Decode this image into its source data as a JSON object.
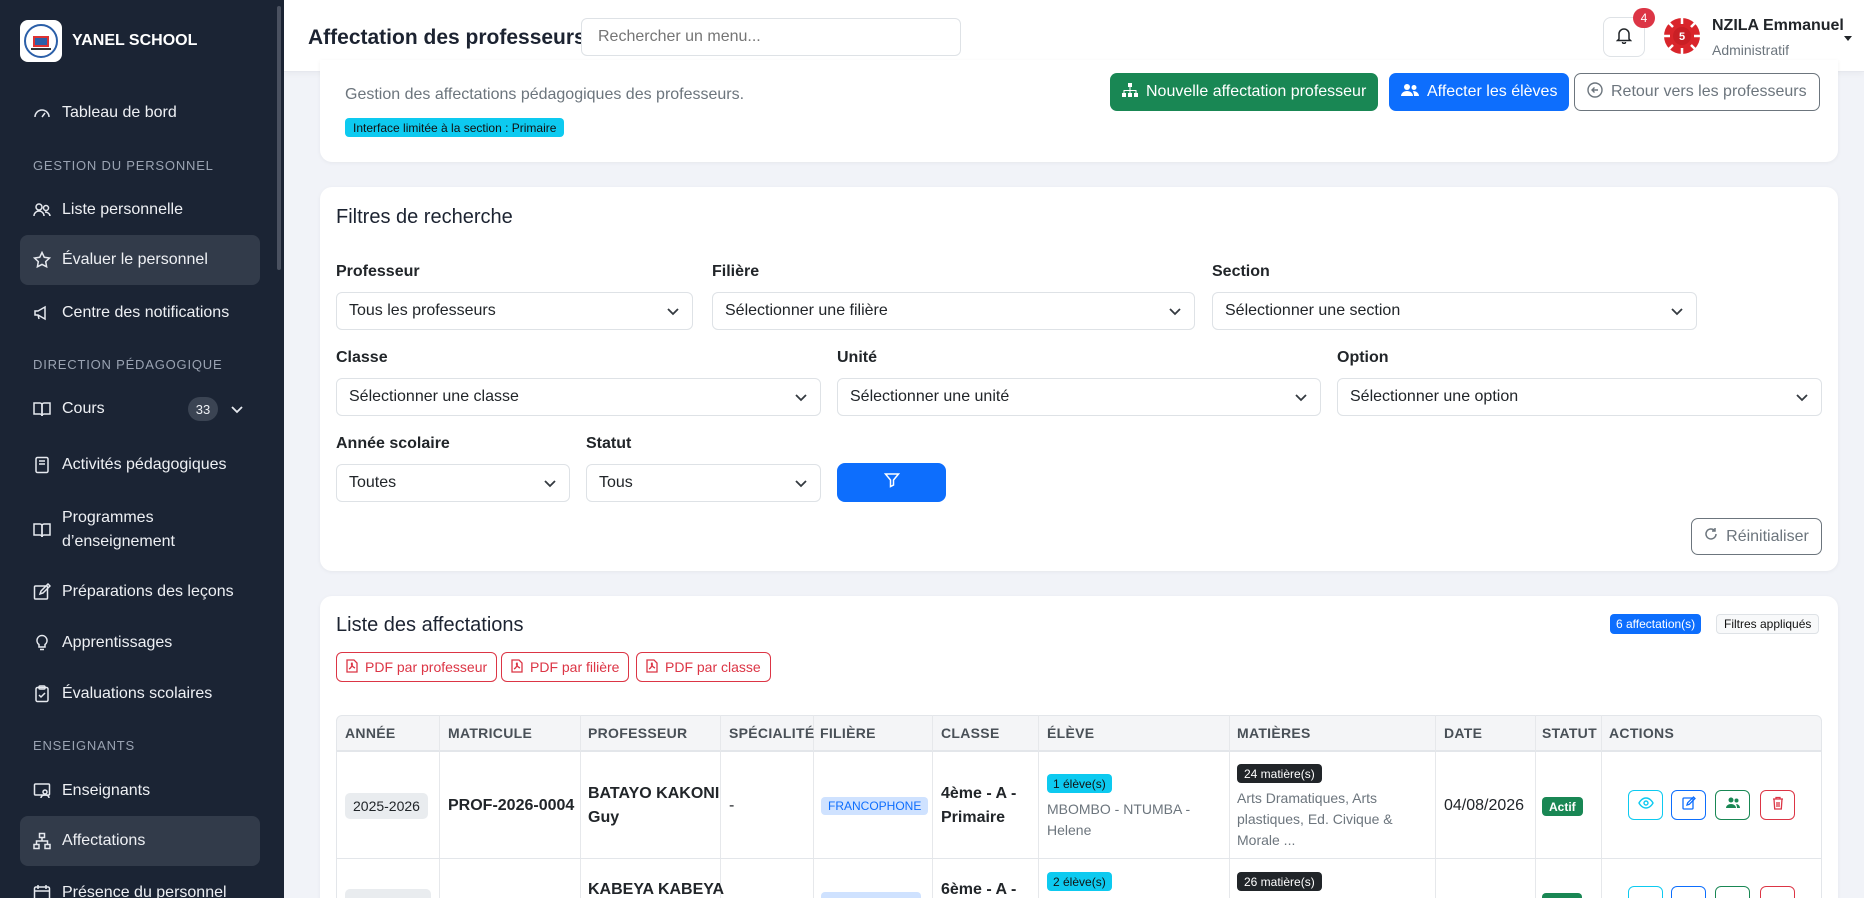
{
  "brand": {
    "name": "YANEL SCHOOL"
  },
  "sidebar": {
    "items": [
      {
        "label": "Tableau de bord"
      },
      {
        "label": "Liste personnelle"
      },
      {
        "label": "Évaluer le personnel"
      },
      {
        "label": "Centre des notifications"
      },
      {
        "label": "Cours",
        "count": "33"
      },
      {
        "label": "Activités pédagogiques"
      },
      {
        "label": "Programmes d’enseignement"
      },
      {
        "label": "Préparations des leçons"
      },
      {
        "label": "Apprentissages"
      },
      {
        "label": "Évaluations scolaires"
      },
      {
        "label": "Enseignants"
      },
      {
        "label": "Affectations"
      },
      {
        "label": "Présence du personnel"
      }
    ],
    "sections": [
      "GESTION DU PERSONNEL",
      "DIRECTION PÉDAGOGIQUE",
      "ENSEIGNANTS"
    ]
  },
  "header": {
    "title": "Affectation des professeurs",
    "search_placeholder": "Rechercher un menu...",
    "notif_count": "4",
    "user_name": "NZILA Emmanuel",
    "user_role": "Administratif",
    "avatar_number": "5"
  },
  "page": {
    "subtitle": "Gestion des affectations pédagogiques des professeurs.",
    "section_note": "Interface limitée à la section : Primaire",
    "btn_new": "Nouvelle affectation professeur",
    "btn_assign": "Affecter les élèves",
    "btn_back": "Retour vers les professeurs"
  },
  "filters": {
    "title": "Filtres de recherche",
    "professeur": {
      "label": "Professeur",
      "value": "Tous les professeurs"
    },
    "filiere": {
      "label": "Filière",
      "value": "Sélectionner une filière"
    },
    "section": {
      "label": "Section",
      "value": "Sélectionner une section"
    },
    "classe": {
      "label": "Classe",
      "value": "Sélectionner une classe"
    },
    "unite": {
      "label": "Unité",
      "value": "Sélectionner une unité"
    },
    "option": {
      "label": "Option",
      "value": "Sélectionner une option"
    },
    "annee": {
      "label": "Année scolaire",
      "value": "Toutes"
    },
    "statut": {
      "label": "Statut",
      "value": "Tous"
    },
    "reset": "Réinitialiser"
  },
  "list": {
    "title": "Liste des affectations",
    "count": "6 affectation(s)",
    "applied": "Filtres appliqués",
    "pdf_prof": "PDF par professeur",
    "pdf_filiere": "PDF par filière",
    "pdf_classe": "PDF par classe",
    "columns": [
      "ANNÉE",
      "MATRICULE",
      "PROFESSEUR",
      "SPÉCIALITÉ",
      "FILIÈRE",
      "CLASSE",
      "ÉLÈVE",
      "MATIÈRES",
      "DATE",
      "STATUT",
      "ACTIONS"
    ],
    "rows": [
      {
        "annee": "2025-2026",
        "matricule": "PROF-2026-0004",
        "prof_line1": "BATAYO KAKONI",
        "prof_line2": "Guy",
        "specialite": "-",
        "filiere": "FRANCOPHONE",
        "classe_line1": "4ème - A -",
        "classe_line2": "Primaire",
        "eleve_count": "1 élève(s)",
        "eleve_line1": "MBOMBO - NTUMBA -",
        "eleve_line2": "Helene",
        "matieres_count": "24 matière(s)",
        "mat_line1": "Arts Dramatiques, Arts",
        "mat_line2": "plastiques, Ed. Civique &",
        "mat_line3": "Morale ...",
        "date": "04/08/2026",
        "statut": "Actif"
      },
      {
        "prof_line1": "KABEYA KABEYA",
        "classe_line1": "6ème - A -",
        "eleve_count": "2 élève(s)",
        "matieres_count": "26 matière(s)"
      }
    ]
  },
  "colors": {
    "primary": "#0d6efd",
    "success": "#198754",
    "danger": "#dc3545",
    "info": "#0dcaf0",
    "sidebar": "#1b2434"
  }
}
